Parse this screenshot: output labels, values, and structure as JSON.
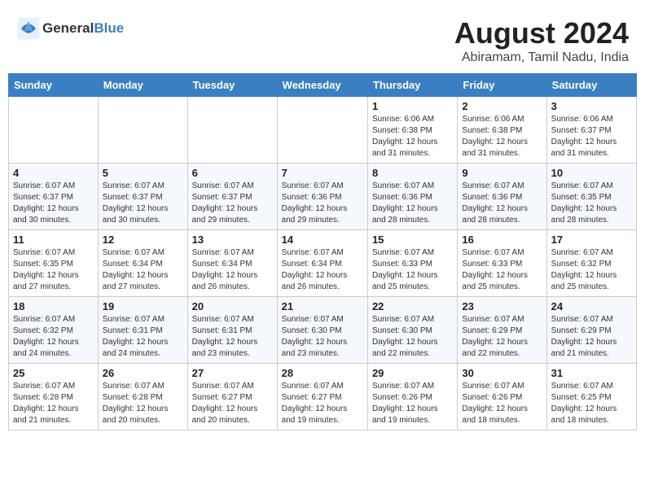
{
  "header": {
    "logo_general": "General",
    "logo_blue": "Blue",
    "title": "August 2024",
    "subtitle": "Abiramam, Tamil Nadu, India"
  },
  "weekdays": [
    "Sunday",
    "Monday",
    "Tuesday",
    "Wednesday",
    "Thursday",
    "Friday",
    "Saturday"
  ],
  "weeks": [
    [
      {
        "day": "",
        "info": ""
      },
      {
        "day": "",
        "info": ""
      },
      {
        "day": "",
        "info": ""
      },
      {
        "day": "",
        "info": ""
      },
      {
        "day": "1",
        "info": "Sunrise: 6:06 AM\nSunset: 6:38 PM\nDaylight: 12 hours\nand 31 minutes."
      },
      {
        "day": "2",
        "info": "Sunrise: 6:06 AM\nSunset: 6:38 PM\nDaylight: 12 hours\nand 31 minutes."
      },
      {
        "day": "3",
        "info": "Sunrise: 6:06 AM\nSunset: 6:37 PM\nDaylight: 12 hours\nand 31 minutes."
      }
    ],
    [
      {
        "day": "4",
        "info": "Sunrise: 6:07 AM\nSunset: 6:37 PM\nDaylight: 12 hours\nand 30 minutes."
      },
      {
        "day": "5",
        "info": "Sunrise: 6:07 AM\nSunset: 6:37 PM\nDaylight: 12 hours\nand 30 minutes."
      },
      {
        "day": "6",
        "info": "Sunrise: 6:07 AM\nSunset: 6:37 PM\nDaylight: 12 hours\nand 29 minutes."
      },
      {
        "day": "7",
        "info": "Sunrise: 6:07 AM\nSunset: 6:36 PM\nDaylight: 12 hours\nand 29 minutes."
      },
      {
        "day": "8",
        "info": "Sunrise: 6:07 AM\nSunset: 6:36 PM\nDaylight: 12 hours\nand 28 minutes."
      },
      {
        "day": "9",
        "info": "Sunrise: 6:07 AM\nSunset: 6:36 PM\nDaylight: 12 hours\nand 28 minutes."
      },
      {
        "day": "10",
        "info": "Sunrise: 6:07 AM\nSunset: 6:35 PM\nDaylight: 12 hours\nand 28 minutes."
      }
    ],
    [
      {
        "day": "11",
        "info": "Sunrise: 6:07 AM\nSunset: 6:35 PM\nDaylight: 12 hours\nand 27 minutes."
      },
      {
        "day": "12",
        "info": "Sunrise: 6:07 AM\nSunset: 6:34 PM\nDaylight: 12 hours\nand 27 minutes."
      },
      {
        "day": "13",
        "info": "Sunrise: 6:07 AM\nSunset: 6:34 PM\nDaylight: 12 hours\nand 26 minutes."
      },
      {
        "day": "14",
        "info": "Sunrise: 6:07 AM\nSunset: 6:34 PM\nDaylight: 12 hours\nand 26 minutes."
      },
      {
        "day": "15",
        "info": "Sunrise: 6:07 AM\nSunset: 6:33 PM\nDaylight: 12 hours\nand 25 minutes."
      },
      {
        "day": "16",
        "info": "Sunrise: 6:07 AM\nSunset: 6:33 PM\nDaylight: 12 hours\nand 25 minutes."
      },
      {
        "day": "17",
        "info": "Sunrise: 6:07 AM\nSunset: 6:32 PM\nDaylight: 12 hours\nand 25 minutes."
      }
    ],
    [
      {
        "day": "18",
        "info": "Sunrise: 6:07 AM\nSunset: 6:32 PM\nDaylight: 12 hours\nand 24 minutes."
      },
      {
        "day": "19",
        "info": "Sunrise: 6:07 AM\nSunset: 6:31 PM\nDaylight: 12 hours\nand 24 minutes."
      },
      {
        "day": "20",
        "info": "Sunrise: 6:07 AM\nSunset: 6:31 PM\nDaylight: 12 hours\nand 23 minutes."
      },
      {
        "day": "21",
        "info": "Sunrise: 6:07 AM\nSunset: 6:30 PM\nDaylight: 12 hours\nand 23 minutes."
      },
      {
        "day": "22",
        "info": "Sunrise: 6:07 AM\nSunset: 6:30 PM\nDaylight: 12 hours\nand 22 minutes."
      },
      {
        "day": "23",
        "info": "Sunrise: 6:07 AM\nSunset: 6:29 PM\nDaylight: 12 hours\nand 22 minutes."
      },
      {
        "day": "24",
        "info": "Sunrise: 6:07 AM\nSunset: 6:29 PM\nDaylight: 12 hours\nand 21 minutes."
      }
    ],
    [
      {
        "day": "25",
        "info": "Sunrise: 6:07 AM\nSunset: 6:28 PM\nDaylight: 12 hours\nand 21 minutes."
      },
      {
        "day": "26",
        "info": "Sunrise: 6:07 AM\nSunset: 6:28 PM\nDaylight: 12 hours\nand 20 minutes."
      },
      {
        "day": "27",
        "info": "Sunrise: 6:07 AM\nSunset: 6:27 PM\nDaylight: 12 hours\nand 20 minutes."
      },
      {
        "day": "28",
        "info": "Sunrise: 6:07 AM\nSunset: 6:27 PM\nDaylight: 12 hours\nand 19 minutes."
      },
      {
        "day": "29",
        "info": "Sunrise: 6:07 AM\nSunset: 6:26 PM\nDaylight: 12 hours\nand 19 minutes."
      },
      {
        "day": "30",
        "info": "Sunrise: 6:07 AM\nSunset: 6:26 PM\nDaylight: 12 hours\nand 18 minutes."
      },
      {
        "day": "31",
        "info": "Sunrise: 6:07 AM\nSunset: 6:25 PM\nDaylight: 12 hours\nand 18 minutes."
      }
    ]
  ]
}
